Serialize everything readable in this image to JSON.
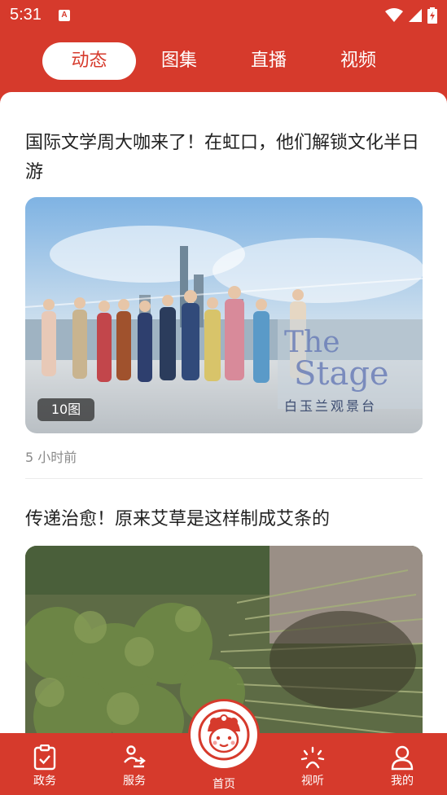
{
  "status_bar": {
    "time": "5:31",
    "notification_icon": "A"
  },
  "tabs": [
    {
      "label": "动态",
      "active": true
    },
    {
      "label": "图集",
      "active": false
    },
    {
      "label": "直播",
      "active": false
    },
    {
      "label": "视频",
      "active": false
    }
  ],
  "articles": [
    {
      "title": "国际文学周大咖来了！在虹口，他们解锁文化半日游",
      "badge": "10图",
      "time": "5 小时前",
      "image_text": "The Stage 白玉兰观景台"
    },
    {
      "title": "传递治愈！原来艾草是这样制成艾条的"
    }
  ],
  "bottom_nav": [
    {
      "label": "政务",
      "icon": "clipboard-check-icon"
    },
    {
      "label": "服务",
      "icon": "person-service-icon"
    },
    {
      "label": "首页",
      "icon": "mascot-home-icon"
    },
    {
      "label": "视听",
      "icon": "broadcast-icon"
    },
    {
      "label": "我的",
      "icon": "user-icon"
    }
  ],
  "colors": {
    "brand_red": "#d63a2c",
    "text": "#222222",
    "muted": "#8a8a8a"
  }
}
